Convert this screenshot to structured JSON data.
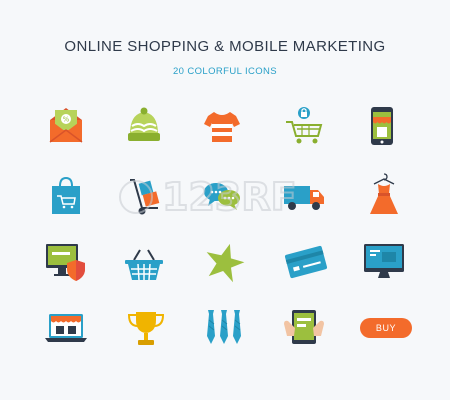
{
  "header": {
    "title": "ONLINE SHOPPING & MOBILE MARKETING",
    "subtitle": "20 COLORFUL ICONS"
  },
  "colors": {
    "title": "#2f3a4a",
    "accent": "#2aa0c8",
    "orange": "#f36b2b",
    "green": "#9cbf3e",
    "red": "#e24d3d"
  },
  "icons": [
    "envelope-discount-icon",
    "knit-hat-icon",
    "striped-tshirt-icon",
    "shopping-cart-lock-icon",
    "mobile-shop-icon",
    "shopping-bag-icon",
    "hand-truck-icon",
    "chat-bubbles-icon",
    "delivery-truck-icon",
    "dress-icon",
    "monitor-shield-icon",
    "shopping-basket-icon",
    "star-icon",
    "credit-card-icon",
    "desktop-monitor-icon",
    "laptop-store-icon",
    "trophy-icon",
    "ties-icon",
    "tablet-hands-icon",
    "buy-button"
  ],
  "buy_label": "BUY",
  "watermark": "123RF"
}
